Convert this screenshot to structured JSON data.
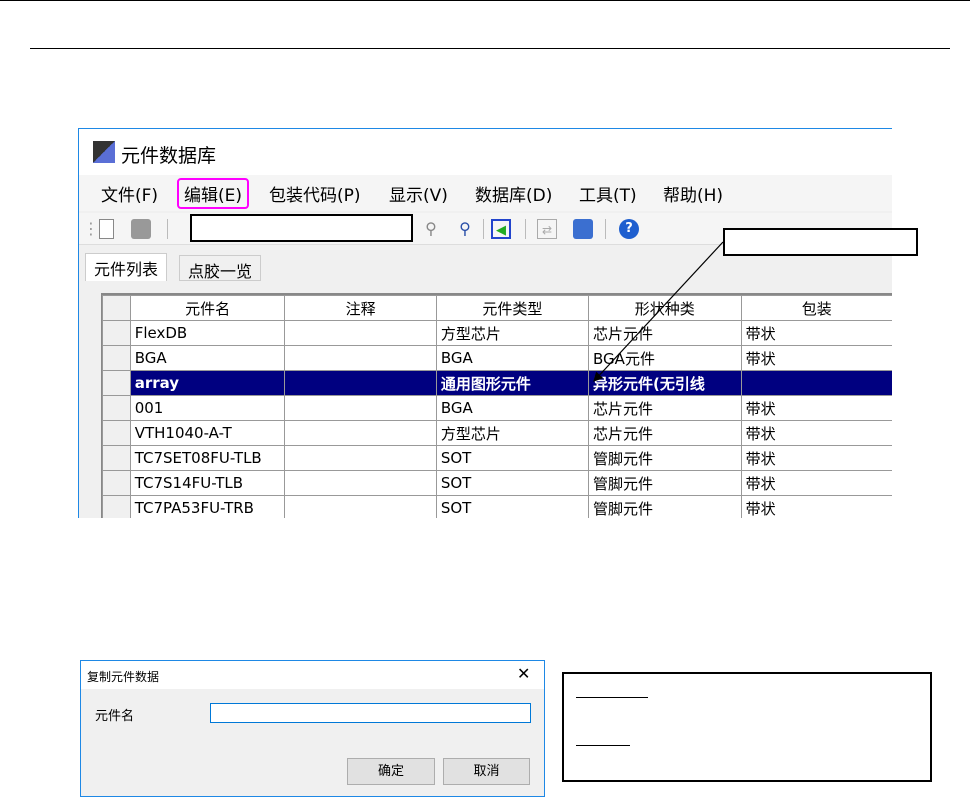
{
  "window": {
    "title": "元件数据库",
    "menu": [
      "文件(F)",
      "编辑(E)",
      "包装代码(P)",
      "显示(V)",
      "数据库(D)",
      "工具(T)",
      "帮助(H)"
    ],
    "tabs": [
      "元件列表",
      "点胶一览"
    ],
    "columns": [
      "元件名",
      "注释",
      "元件类型",
      "形状种类",
      "包装"
    ],
    "rows": [
      [
        "FlexDB",
        "",
        "方型芯片",
        "芯片元件",
        "带状"
      ],
      [
        "BGA",
        "",
        "BGA",
        "BGA元件",
        "带状"
      ],
      [
        "array",
        "",
        "通用图形元件",
        "异形元件(无引线",
        ""
      ],
      [
        "001",
        "",
        "BGA",
        "芯片元件",
        "带状"
      ],
      [
        "VTH1040-A-T",
        "",
        "方型芯片",
        "芯片元件",
        "带状"
      ],
      [
        "TC7SET08FU-TLB",
        "",
        "SOT",
        "管脚元件",
        "带状"
      ],
      [
        "TC7S14FU-TLB",
        "",
        "SOT",
        "管脚元件",
        "带状"
      ],
      [
        "TC7PA53FU-TRB",
        "",
        "SOT",
        "管脚元件",
        "带状"
      ]
    ],
    "selected_row": 2
  },
  "dialog": {
    "title": "复制元件数据",
    "field_label": "元件名",
    "field_value": "",
    "ok": "确定",
    "cancel": "取消",
    "close": "✕"
  },
  "colors": {
    "highlight": "#ff00ff",
    "selection": "#000080"
  }
}
